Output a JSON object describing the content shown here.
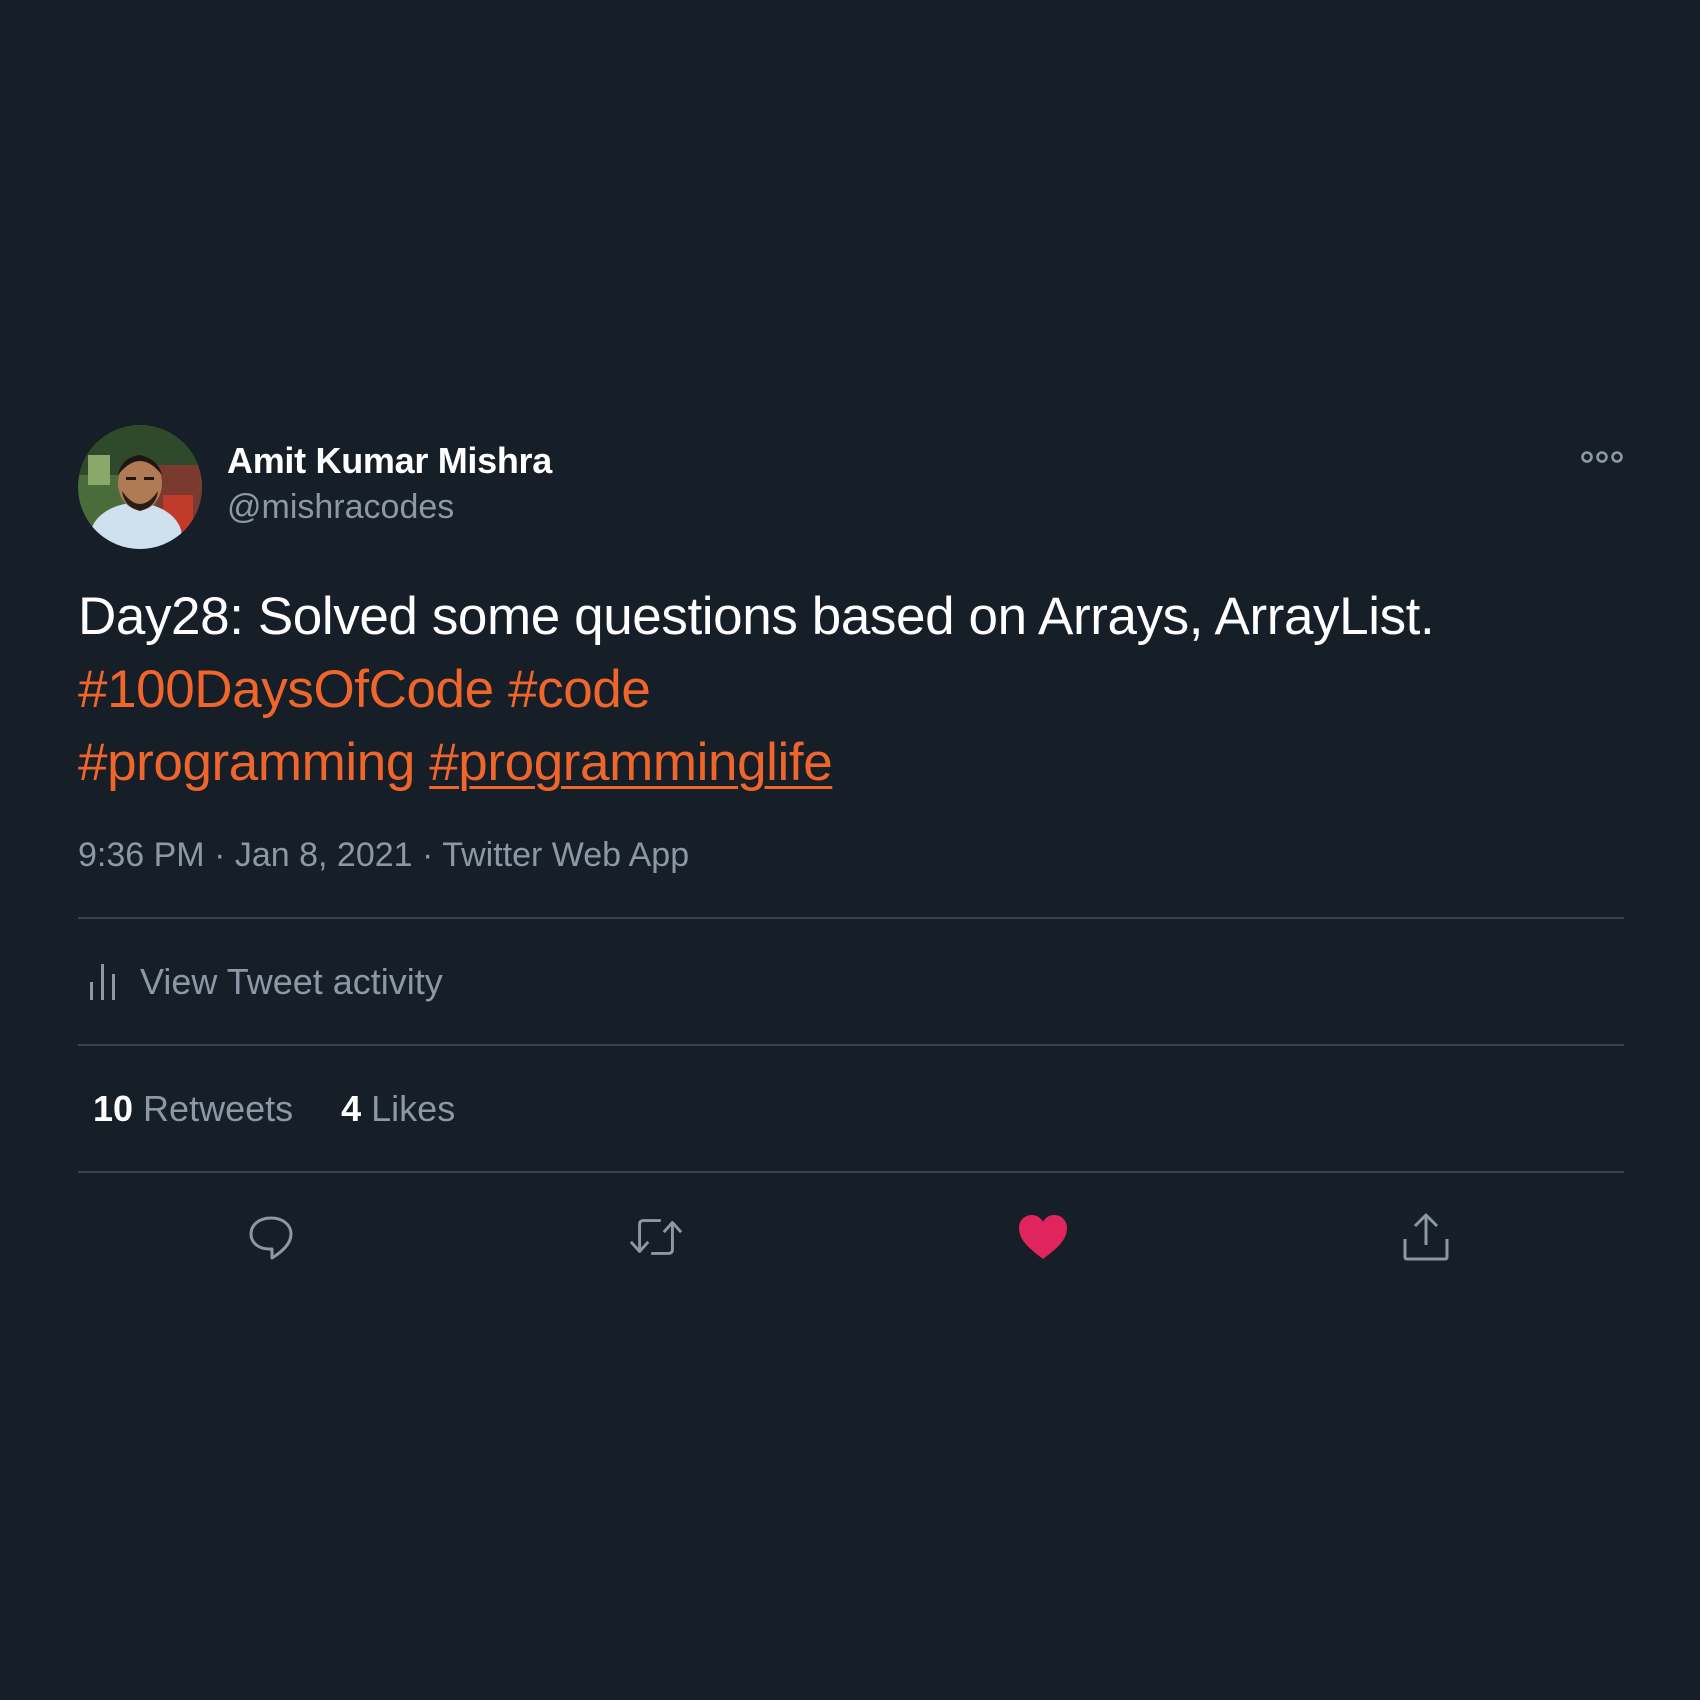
{
  "tweet": {
    "author": {
      "display_name": "Amit Kumar Mishra",
      "handle": "@mishracodes",
      "avatar": "profile-photo"
    },
    "more_icon": "more-options-icon",
    "text": {
      "line1": "Day28: Solved some questions based on Arrays, ArrayList.",
      "hashtags": [
        "#100DaysOfCode",
        "#code",
        "#programming",
        "#programminglife"
      ]
    },
    "meta": {
      "time": "9:36 PM",
      "separator": "·",
      "date": "Jan 8, 2021",
      "source": "Twitter Web App"
    },
    "activity_label": "View Tweet activity",
    "stats": {
      "retweets_count": "10",
      "retweets_label": "Retweets",
      "likes_count": "4",
      "likes_label": "Likes"
    },
    "actions": {
      "reply_icon": "reply-icon",
      "retweet_icon": "retweet-icon",
      "like_icon": "heart-icon",
      "share_icon": "share-icon"
    }
  },
  "colors": {
    "background": "#161e28",
    "primary_text": "#ffffff",
    "secondary_text": "#8b98a5",
    "hashtag": "#f0652a",
    "like": "#e0245e",
    "divider": "#38444d"
  }
}
